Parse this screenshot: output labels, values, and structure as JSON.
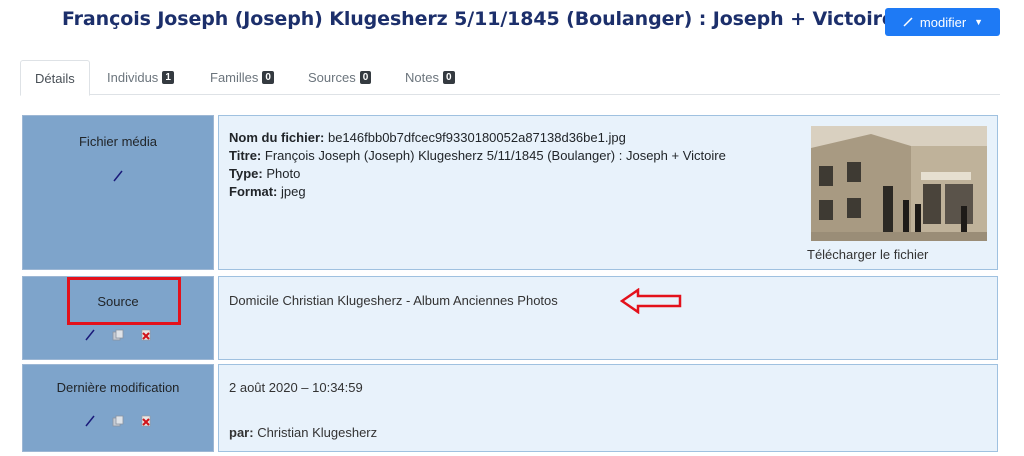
{
  "header": {
    "title": "François Joseph (Joseph) Klugesherz 5/11/1845 (Boulanger) : Joseph + Victoire",
    "modify_label": "modifier"
  },
  "tabs": [
    {
      "label": "Détails",
      "badge": null
    },
    {
      "label": "Individus",
      "badge": "1"
    },
    {
      "label": "Familles",
      "badge": "0"
    },
    {
      "label": "Sources",
      "badge": "0"
    },
    {
      "label": "Notes",
      "badge": "0"
    }
  ],
  "media": {
    "label": "Fichier média",
    "filename_label": "Nom du fichier:",
    "filename": "be146fbb0b7dfcec9f9330180052a87138d36be1.jpg",
    "title_label": "Titre:",
    "title": "François Joseph (Joseph) Klugesherz 5/11/1845 (Boulanger) : Joseph + Victoire",
    "type_label": "Type:",
    "type": "Photo",
    "format_label": "Format:",
    "format": "jpeg",
    "download_label": "Télécharger le fichier"
  },
  "source": {
    "label": "Source",
    "text": "Domicile Christian Klugesherz - Album Anciennes Photos"
  },
  "last_modified": {
    "label": "Dernière modification",
    "datetime": "2 août 2020 – 10:34:59",
    "by_label": "par:",
    "by": "Christian Klugesherz"
  },
  "colors": {
    "title": "#1c2f6b",
    "button": "#1e7af5",
    "label_cell": "#7ea4cb",
    "content_cell": "#e8f2fb",
    "highlight": "#e3111b"
  }
}
